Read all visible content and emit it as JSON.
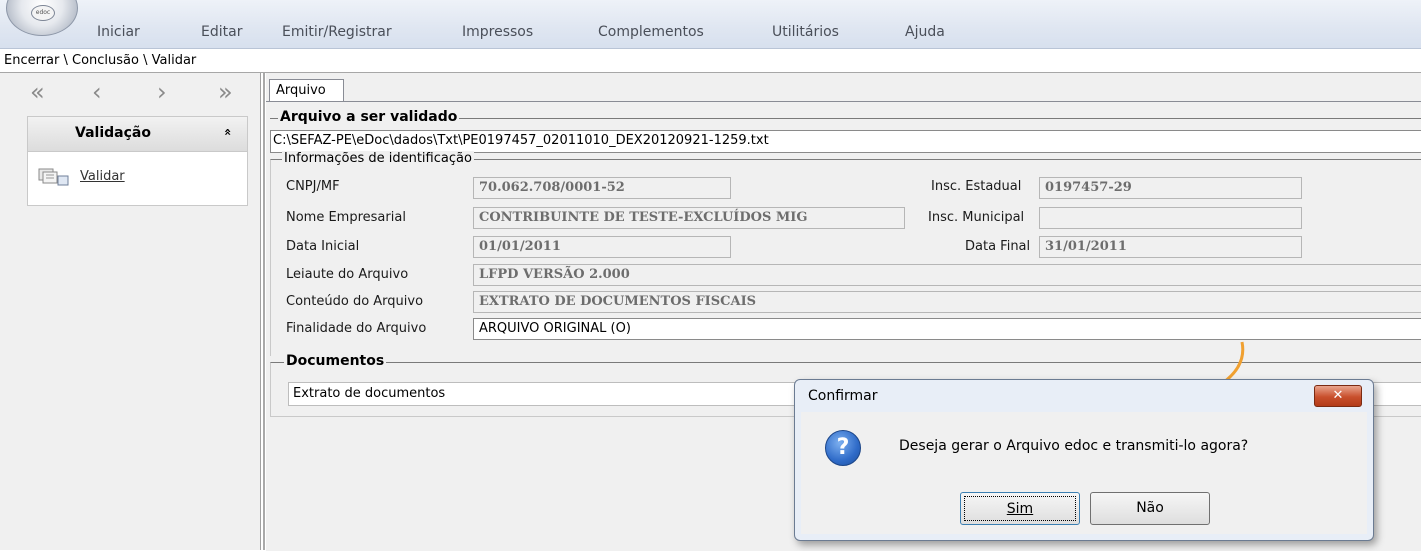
{
  "menubar": {
    "items": [
      "Iniciar",
      "Editar",
      "Emitir/Registrar",
      "Impressos",
      "Complementos",
      "Utilitários",
      "Ajuda"
    ]
  },
  "breadcrumb": "Encerrar \\ Conclusão \\ Validar",
  "sidebar": {
    "nav_arrows": [
      "«",
      "‹",
      "›",
      "»"
    ],
    "panel_title": "Validação",
    "collapse_glyph": "«",
    "item_label": "Validar"
  },
  "tab": {
    "label": "Arquivo"
  },
  "file_section": {
    "legend": "Arquivo a ser validado",
    "path": "C:\\SEFAZ-PE\\eDoc\\dados\\Txt\\PE0197457_02011010_DEX20120921-1259.txt"
  },
  "identification": {
    "legend": "Informações de identificação",
    "cnpj_label": "CNPJ/MF",
    "cnpj_value": "70.062.708/0001-52",
    "ie_label": "Insc. Estadual",
    "ie_value": "0197457-29",
    "nome_label": "Nome Empresarial",
    "nome_value": "CONTRIBUINTE DE TESTE-EXCLUÍDOS MIG",
    "im_label": "Insc. Municipal",
    "im_value": "",
    "data_ini_label": "Data Inicial",
    "data_ini_value": "01/01/2011",
    "data_fim_label": "Data Final",
    "data_fim_value": "31/01/2011",
    "leiaute_label": "Leiaute do Arquivo",
    "leiaute_value": "LFPD VERSÃO 2.000",
    "conteudo_label": "Conteúdo do Arquivo",
    "conteudo_value": "EXTRATO DE DOCUMENTOS FISCAIS",
    "finalidade_label": "Finalidade do Arquivo",
    "finalidade_value": "ARQUIVO ORIGINAL (O)"
  },
  "documents": {
    "legend": "Documentos",
    "item": "Extrato de documentos"
  },
  "dialog": {
    "title": "Confirmar",
    "close_glyph": "✕",
    "message": "Deseja gerar o Arquivo edoc e transmiti-lo agora?",
    "yes_label": "Sim",
    "no_label": "Não"
  },
  "colors": {
    "annotation_arrow": "#f0a030",
    "close_button": "#c84f2c"
  }
}
